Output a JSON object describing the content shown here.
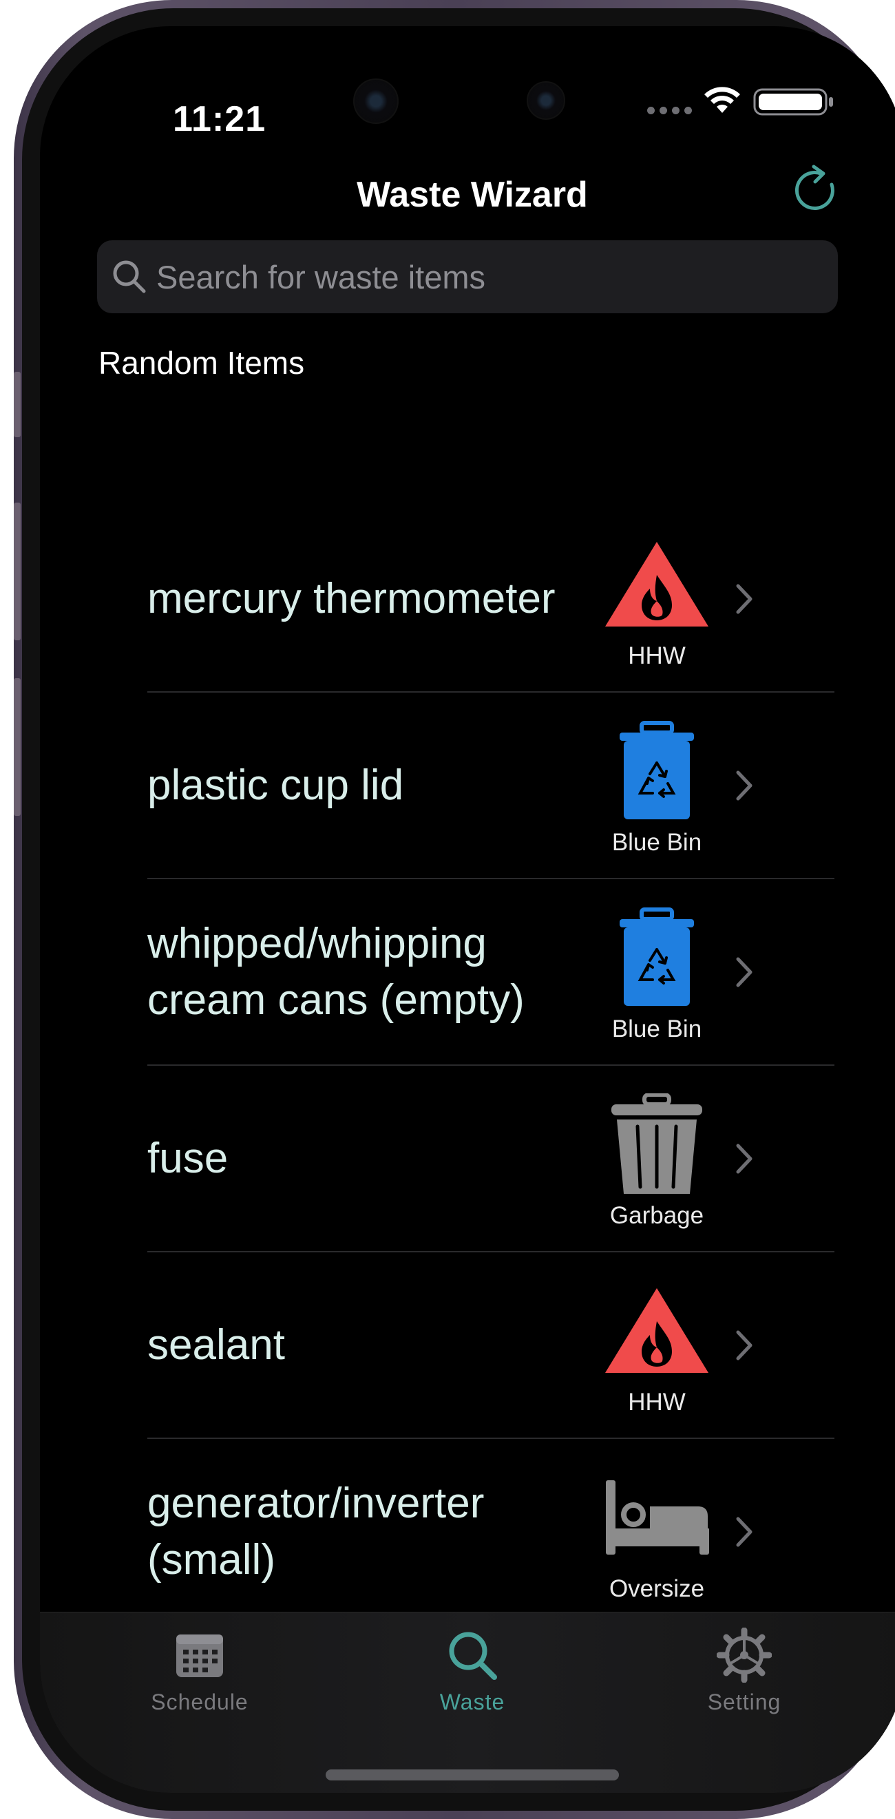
{
  "status_bar": {
    "time": "11:21"
  },
  "nav": {
    "title": "Waste Wizard",
    "refresh_icon": "refresh-icon"
  },
  "search": {
    "placeholder": "Search for waste items",
    "value": ""
  },
  "section": {
    "title": "Random Items"
  },
  "items": [
    {
      "name": "mercury thermometer",
      "category": "HHW",
      "icon": "hazard-icon",
      "color": "#f04b4b"
    },
    {
      "name": "plastic cup lid",
      "category": "Blue Bin",
      "icon": "recycle-bin-icon",
      "color": "#1f7fe0"
    },
    {
      "name": "whipped/whipping cream cans (empty)",
      "category": "Blue Bin",
      "icon": "recycle-bin-icon",
      "color": "#1f7fe0"
    },
    {
      "name": "fuse",
      "category": "Garbage",
      "icon": "trash-can-icon",
      "color": "#8c8c8c"
    },
    {
      "name": "sealant",
      "category": "HHW",
      "icon": "hazard-icon",
      "color": "#f04b4b"
    },
    {
      "name": "generator/inverter (small)",
      "category": "Oversize",
      "icon": "bed-icon",
      "color": "#8c8c8c"
    }
  ],
  "tabs": [
    {
      "label": "Schedule",
      "icon": "calendar-icon",
      "active": false
    },
    {
      "label": "Waste",
      "icon": "search-icon",
      "active": true
    },
    {
      "label": "Setting",
      "icon": "gear-icon",
      "active": false
    }
  ],
  "colors": {
    "accent": "#49a29a",
    "background": "#000000",
    "item_text": "#d9eeea"
  }
}
